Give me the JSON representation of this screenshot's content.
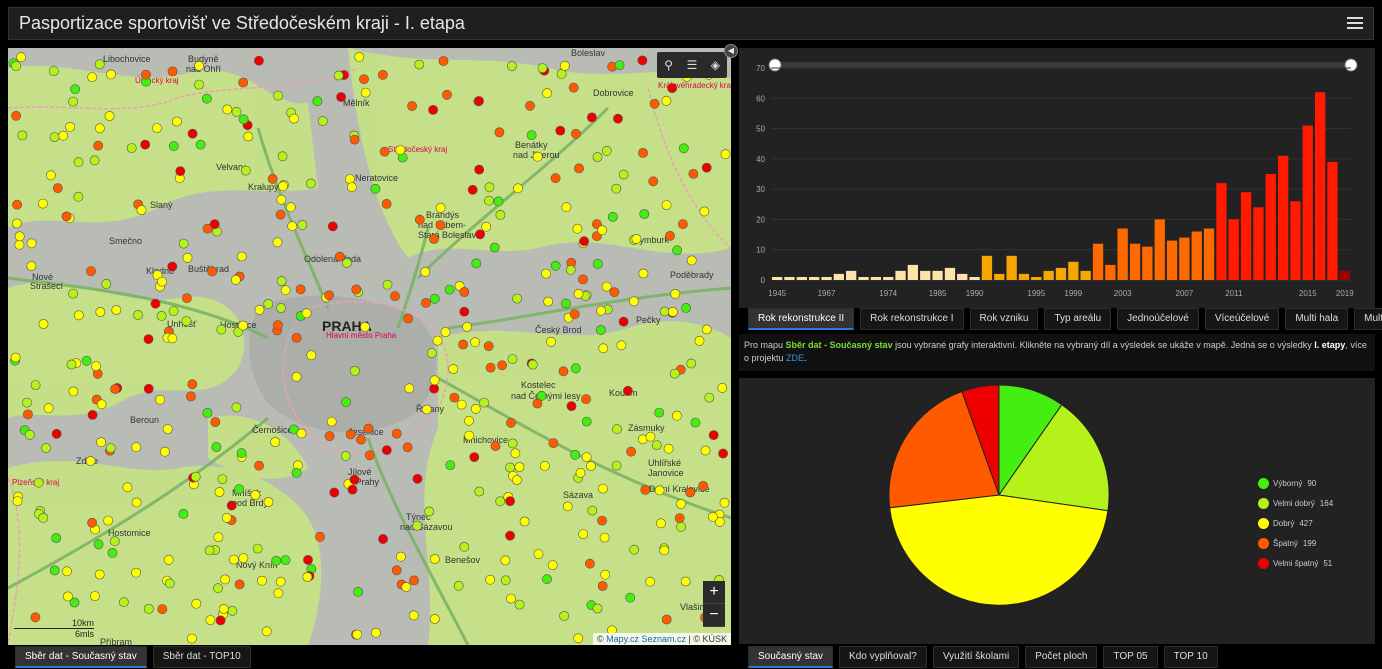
{
  "header": {
    "title": "Pasportizace sportovišť ve Středočeském kraji - I. etapa"
  },
  "map": {
    "places": [
      {
        "label": "Libochovice"
      },
      {
        "label": "Budyně\nnad Ohří"
      },
      {
        "label": "Ústecký kraj"
      },
      {
        "label": "Mělník"
      },
      {
        "label": "Boleslav"
      },
      {
        "label": "Dobrovice"
      },
      {
        "label": "Královéhradecký kraj"
      },
      {
        "label": "Velvary"
      },
      {
        "label": "Kralupy"
      },
      {
        "label": "Neratovice"
      },
      {
        "label": "Středočeský kraj"
      },
      {
        "label": "Benátky\nnad Jizerou"
      },
      {
        "label": "Smečno"
      },
      {
        "label": "Slaný"
      },
      {
        "label": "Brandýs\nnad Labem-\nStará Boleslav"
      },
      {
        "label": "Nymburk"
      },
      {
        "label": "Kladno"
      },
      {
        "label": "Buštěhrad"
      },
      {
        "label": "Odolena Voda"
      },
      {
        "label": "Poděbrady"
      },
      {
        "label": "Nové Strašecí"
      },
      {
        "label": "Unhošť"
      },
      {
        "label": "Hostivice"
      },
      {
        "label": "PRAHA"
      },
      {
        "label": "Hlavní město Praha"
      },
      {
        "label": "Český Brod"
      },
      {
        "label": "Pečky"
      },
      {
        "label": "Beroun"
      },
      {
        "label": "Kostelec\nnad Černými lesy"
      },
      {
        "label": "Kouřim"
      },
      {
        "label": "Černošice"
      },
      {
        "label": "Zásmuky"
      },
      {
        "label": "Zdice"
      },
      {
        "label": "Mnichovice"
      },
      {
        "label": "Jesenice"
      },
      {
        "label": "Říčany"
      },
      {
        "label": "Jílové\nu Prahy"
      },
      {
        "label": "Mníšek\npod Brdy"
      },
      {
        "label": "Týnec\nnad Sázavou"
      },
      {
        "label": "Hostomice"
      },
      {
        "label": "Sázava"
      },
      {
        "label": "Dolní Kralovice"
      },
      {
        "label": "Nový Knín"
      },
      {
        "label": "Benešov"
      },
      {
        "label": "Příbram"
      },
      {
        "label": "Plzeňský kraj"
      },
      {
        "label": "Vlašim"
      },
      {
        "label": "Uhlířské\nJanovice"
      }
    ],
    "scale": "10km\n6mls",
    "attribution_text": "© Mapy.cz Seznam.cz | © KÚSK",
    "attribution_link": "Mapy.cz Seznam.cz",
    "tools": [
      "search-icon",
      "list-icon",
      "layers-icon"
    ],
    "zoom_in": "+",
    "zoom_out": "−"
  },
  "left_tabs": [
    "Sběr dat - Současný stav",
    "Sběr dat - TOP10"
  ],
  "chart_tabs": [
    "Rok rekonstrukce II",
    "Rok rekonstrukce I",
    "Rok vzniku",
    "Typ areálu",
    "Jednoúčelové",
    "Víceúčelové",
    "Multi hala",
    "Multi hřiště"
  ],
  "info": {
    "prefix": "Pro mapu ",
    "highlight": "Sběr dat - Současný stav",
    "middle": " jsou vybrané grafy interaktivní. Klikněte na vybraný díl a výsledek se ukáže v mapě. Jedná se o výsledky ",
    "bold": "I. etapy",
    "suffix": ", více o projektu ",
    "link": "ZDE",
    "end": "."
  },
  "right_tabs": [
    "Současný stav",
    "Kdo vyplňoval?",
    "Využití školami",
    "Počet ploch",
    "TOP 05",
    "TOP 10"
  ],
  "chart_data": [
    {
      "type": "bar",
      "title": "",
      "xlabel": "",
      "ylabel": "",
      "ylim": [
        0,
        70
      ],
      "yticks": [
        0,
        10,
        20,
        30,
        40,
        50,
        60,
        70
      ],
      "xticks": [
        "1945",
        "1967",
        "1974",
        "1985",
        "1990",
        "1995",
        "1999",
        "2003",
        "2007",
        "2011",
        "2015",
        "2019"
      ],
      "values": [
        1,
        1,
        1,
        1,
        1,
        2,
        3,
        1,
        1,
        1,
        3,
        5,
        3,
        3,
        4,
        2,
        1,
        8,
        2,
        8,
        2,
        1,
        3,
        4,
        6,
        3,
        12,
        5,
        17,
        12,
        11,
        20,
        13,
        14,
        16,
        17,
        32,
        20,
        29,
        24,
        35,
        41,
        26,
        51,
        62,
        39,
        3
      ],
      "colors": [
        "#fde3a7",
        "#fde3a7",
        "#fde3a7",
        "#fde3a7",
        "#fde3a7",
        "#fde3a7",
        "#fde3a7",
        "#fde3a7",
        "#fde3a7",
        "#fde3a7",
        "#fde3a7",
        "#fde3a7",
        "#fde3a7",
        "#fde3a7",
        "#fde3a7",
        "#fde3a7",
        "#fde3a7",
        "#f7a600",
        "#f7a600",
        "#f7a600",
        "#f7a600",
        "#f7a600",
        "#f7a600",
        "#f7a600",
        "#f7a600",
        "#f7a600",
        "#ff6a00",
        "#ff6a00",
        "#ff6a00",
        "#ff6a00",
        "#ff6a00",
        "#ff6a00",
        "#ff6a00",
        "#ff6a00",
        "#ff6a00",
        "#ff6a00",
        "#ff1a00",
        "#ff1a00",
        "#ff1a00",
        "#ff1a00",
        "#ff1a00",
        "#ff1a00",
        "#ff1a00",
        "#ff1a00",
        "#ff1a00",
        "#ff1a00",
        "#a00000"
      ]
    },
    {
      "type": "pie",
      "title": "",
      "slices": [
        {
          "label": "Výborný",
          "value": 90,
          "color": "#44ee11"
        },
        {
          "label": "Velmi dobrý",
          "value": 164,
          "color": "#b4f21a"
        },
        {
          "label": "Dobrý",
          "value": 427,
          "color": "#ffff00"
        },
        {
          "label": "Špatný",
          "value": 199,
          "color": "#ff5a00"
        },
        {
          "label": "Velmi špatný",
          "value": 51,
          "color": "#ee0000"
        }
      ]
    }
  ]
}
